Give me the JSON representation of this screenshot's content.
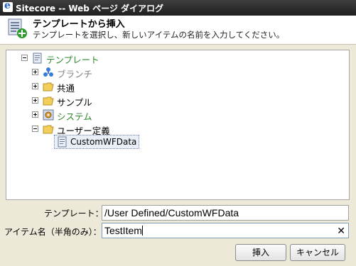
{
  "window": {
    "title": "Sitecore -- Web ページ ダイアログ"
  },
  "header": {
    "title": "テンプレートから挿入",
    "subtitle": "テンプレートを選択し、新しいアイテムの名前を入力してください。"
  },
  "tree": {
    "root": {
      "label": "テンプレート",
      "icon": "template-icon",
      "expanded": true
    },
    "children": [
      {
        "label": "ブランチ",
        "icon": "branch-icon",
        "expanded": false
      },
      {
        "label": "共通",
        "icon": "folder-icon",
        "expanded": false
      },
      {
        "label": "サンプル",
        "icon": "folder-icon",
        "expanded": false
      },
      {
        "label": "システム",
        "icon": "system-gear-icon",
        "expanded": false
      },
      {
        "label": "ユーザー定義",
        "icon": "folder-icon",
        "expanded": true
      }
    ],
    "selected": {
      "label": "CustomWFData",
      "icon": "template-item-icon"
    }
  },
  "form": {
    "template_label": "テンプレート：",
    "template_value": "/User Defined/CustomWFData",
    "item_name_label": "アイテム名（半角のみ）：",
    "item_name_value": "TestItem",
    "clear_symbol": "✕"
  },
  "buttons": {
    "insert": "挿入",
    "cancel": "キャンセル"
  },
  "colors": {
    "green_label": "#2f8a2f",
    "grey_label": "#808080",
    "titlebar": "#2a2a2a"
  }
}
